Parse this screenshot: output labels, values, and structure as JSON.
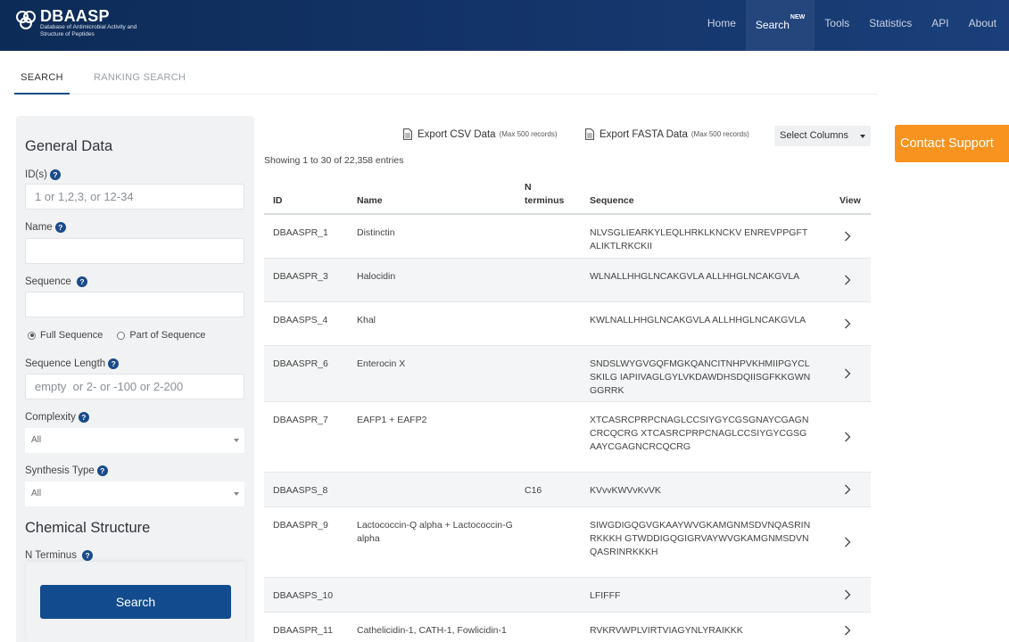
{
  "brand": {
    "title": "DBAASP",
    "subtitle": "Database of Antimicrobial Activity and Structure of Peptides"
  },
  "nav": [
    {
      "label": "Home",
      "badge": ""
    },
    {
      "label": "Search",
      "badge": "NEW"
    },
    {
      "label": "Tools",
      "badge": ""
    },
    {
      "label": "Statistics",
      "badge": ""
    },
    {
      "label": "API",
      "badge": ""
    },
    {
      "label": "About",
      "badge": ""
    }
  ],
  "tabs": {
    "search": "SEARCH",
    "ranking": "RANKING SEARCH"
  },
  "sidebar": {
    "general_heading": "General Data",
    "ids_label": "ID(s)",
    "ids_placeholder": "1 or 1,2,3, or 12-34",
    "name_label": "Name",
    "sequence_label": "Sequence",
    "radio_full": "Full Sequence",
    "radio_part": "Part of Sequence",
    "seq_length_label": "Sequence Length",
    "seq_length_placeholder": "empty  or 2- or -100 or 2-200",
    "complexity_label": "Complexity",
    "complexity_value": "All",
    "synthesis_label": "Synthesis Type",
    "synthesis_value": "All",
    "chemical_heading": "Chemical Structure",
    "n_terminus_label": "N Terminus",
    "help_glyph": "?",
    "search_button": "Search"
  },
  "toolbar": {
    "export_csv": "Export CSV Data",
    "export_csv_note": "(Max 500 records)",
    "export_fasta": "Export FASTA Data",
    "export_fasta_note": "(Max 500 records)",
    "select_columns": "Select Columns",
    "contact_support": "Contact Support"
  },
  "showing": "Showing 1 to 30 of 22,358 entries",
  "table": {
    "headers": {
      "id": "ID",
      "name": "Name",
      "n_terminus": "N terminus",
      "sequence": "Sequence",
      "view": "View"
    },
    "rows": [
      {
        "id": "DBAASPR_1",
        "name": "Distinctin",
        "n_terminus": "",
        "sequence": "NLVSGLIEARKYLEQLHRKLKNCKV ENREVPPGFTALIKTLRKCKII"
      },
      {
        "id": "DBAASPR_3",
        "name": "Halocidin",
        "n_terminus": "",
        "sequence": "WLNALLHHGLNCAKGVLA ALLHHGLNCAKGVLA"
      },
      {
        "id": "DBAASPS_4",
        "name": "Khal",
        "n_terminus": "",
        "sequence": "KWLNALLHHGLNCAKGVLA ALLHHGLNCAKGVLA"
      },
      {
        "id": "DBAASPR_6",
        "name": "Enterocin X",
        "n_terminus": "",
        "sequence": "SNDSLWYGVGQFMGKQANCITNHPVKHMIIPGYCLSKILG IAPIIVAGLGYLVKDAWDHSDQIISGFKKGWNGGRRK"
      },
      {
        "id": "DBAASPR_7",
        "name": "EAFP1 + EAFP2",
        "n_terminus": "",
        "sequence": "XTCASRCPRPCNAGLCCSIYGYCGSGNAYCGAGNCRCQCRG XTCASRCPRPCNAGLCCSIYGYCGSGAAYCGAGNCRCQCRG"
      },
      {
        "id": "DBAASPS_8",
        "name": "",
        "n_terminus": "C16",
        "sequence": "KVvvKWVvKvVK"
      },
      {
        "id": "DBAASPR_9",
        "name": "Lactococcin-Q alpha + Lactococcin-G alpha",
        "n_terminus": "",
        "sequence": "SIWGDIGQGVGKAAYWVGKAMGNMSDVNQASRINRKKKH GTWDDIGQGIGRVAYWVGKAMGNMSDVNQASRINRKKKH"
      },
      {
        "id": "DBAASPS_10",
        "name": "",
        "n_terminus": "",
        "sequence": "LFIFFF"
      },
      {
        "id": "DBAASPR_11",
        "name": "Cathelicidin-1, CATH-1, Fowlicidin-1",
        "n_terminus": "",
        "sequence": "RVKRVWPLVIRTVIAGYNLYRAIKKK"
      }
    ]
  },
  "colors": {
    "header": "#14356a",
    "primary": "#124c8e",
    "accent": "#f7931e"
  }
}
